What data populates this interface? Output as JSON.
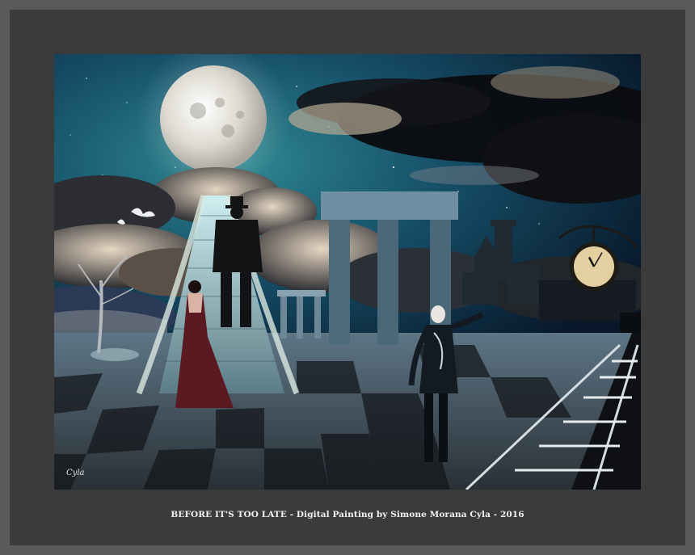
{
  "caption": "BEFORE IT'S TOO LATE - Digital Painting by Simone Morana Cyla - 2016",
  "signature": "Cyla",
  "palette": {
    "sky_top": "#0d2a3d",
    "sky_glow": "#2d7f8a",
    "moon": "#e8e6df",
    "floor_dark": "#1c1f24",
    "floor_light": "#6a7c88",
    "dress": "#5b1a22",
    "mat": "#3b3b3b",
    "outer": "#5a5a5a"
  },
  "clock": {
    "hours": 11,
    "minutes": 5
  }
}
